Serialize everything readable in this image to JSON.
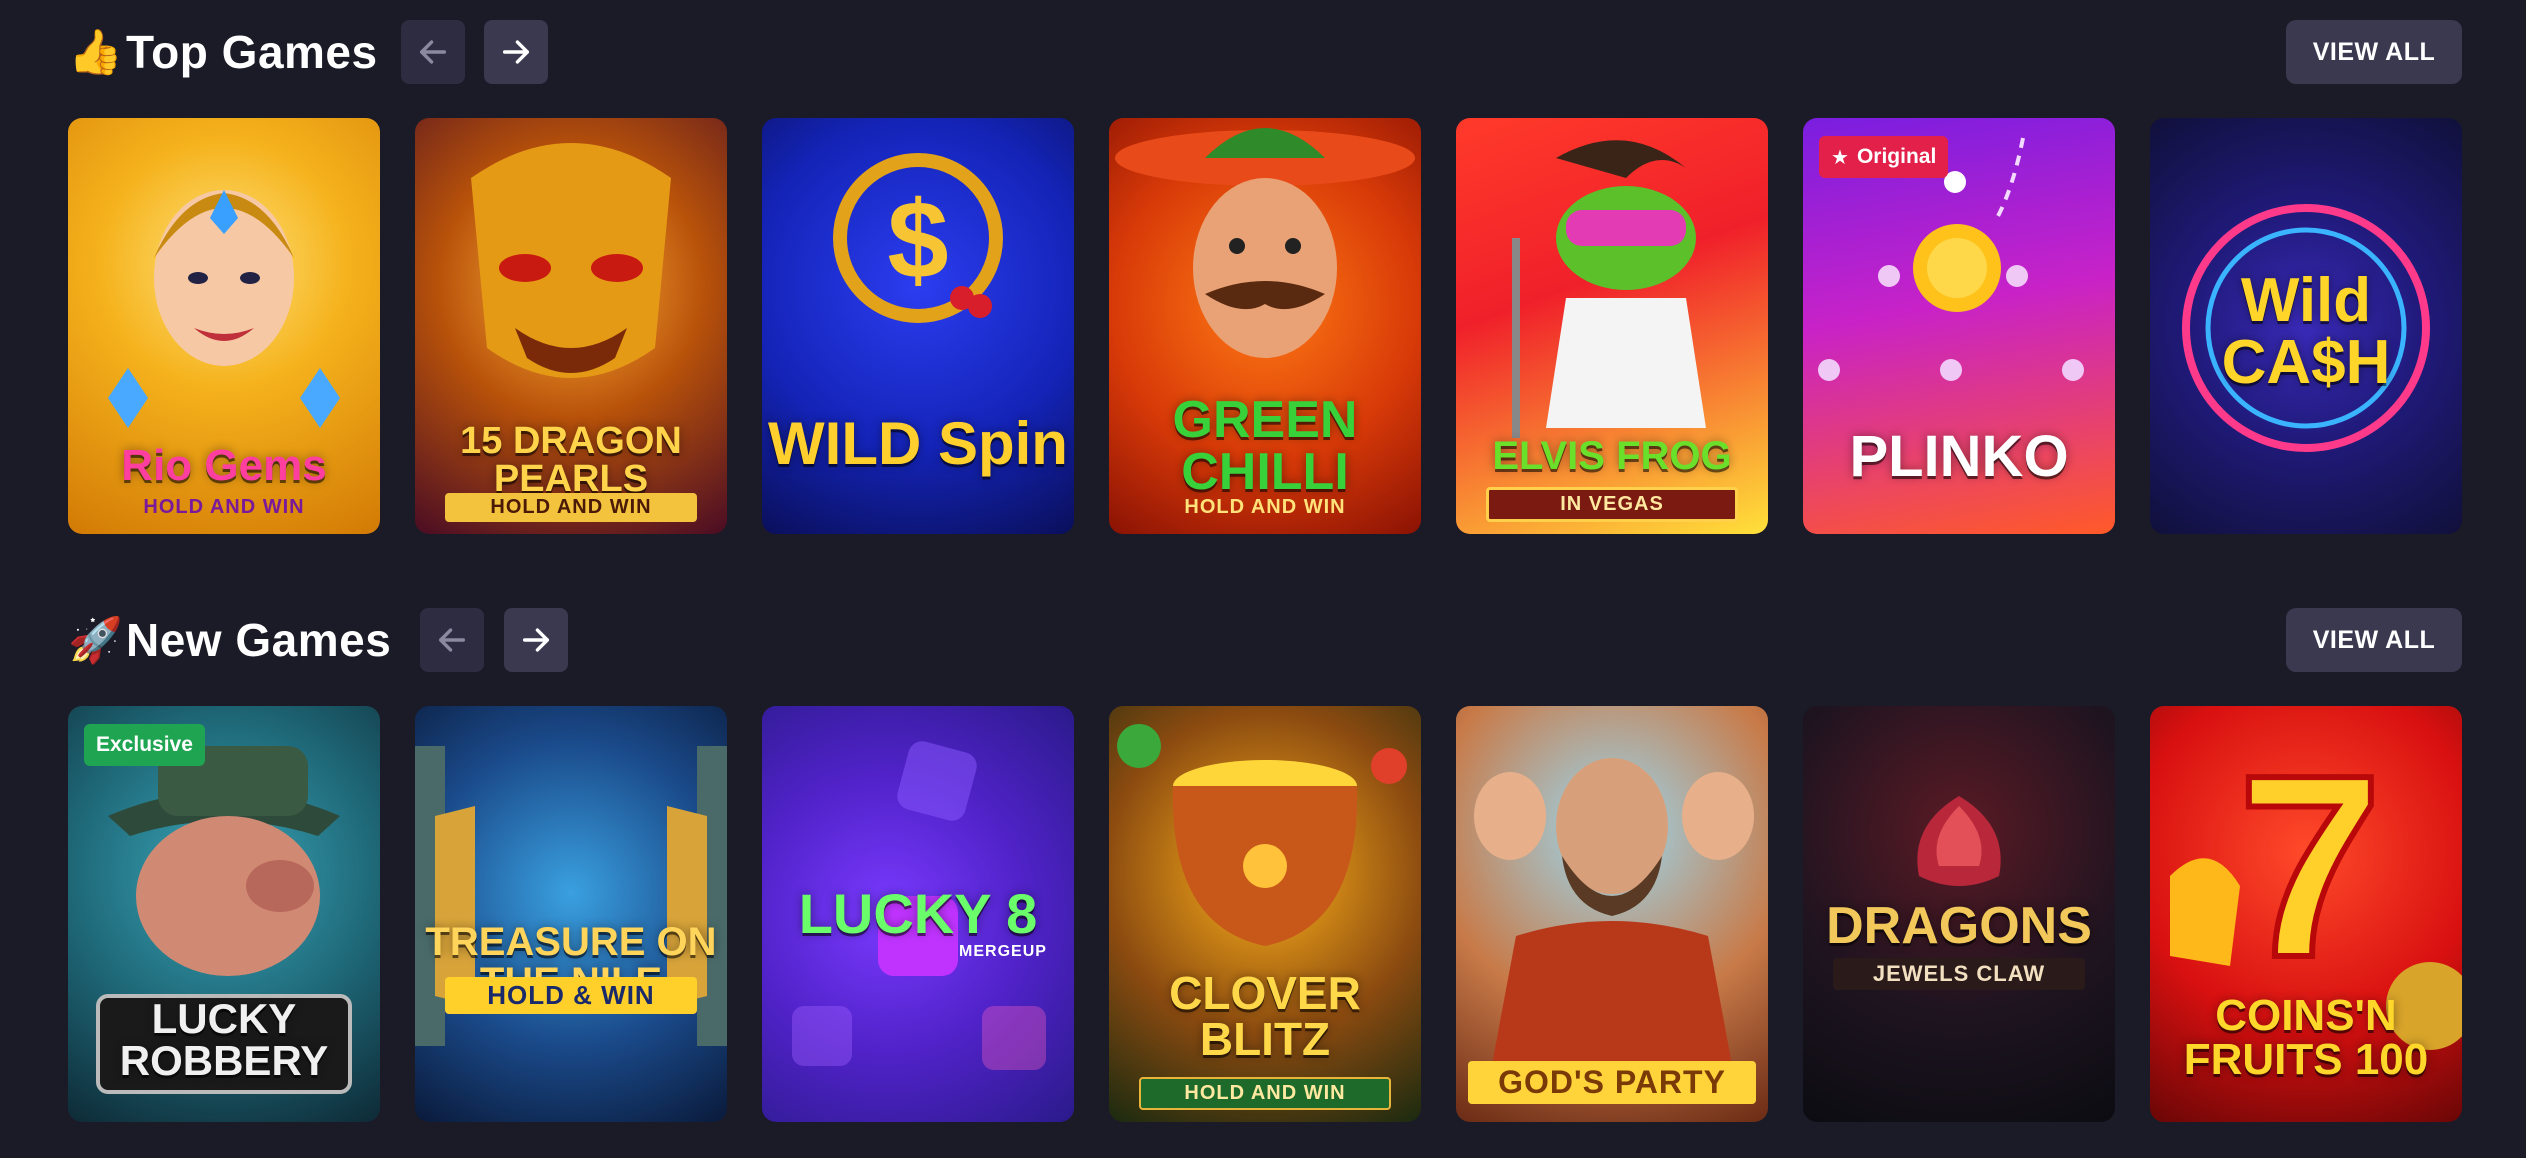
{
  "top_games": {
    "emoji": "👍",
    "title": "Top Games",
    "view_all": "VIEW ALL",
    "games": [
      {
        "name": "Rio Gems",
        "sub": "HOLD AND WIN"
      },
      {
        "name": "15 DRAGON PEARLS",
        "sub": "HOLD AND WIN"
      },
      {
        "name": "WILD Spin",
        "sub": ""
      },
      {
        "name": "GREEN CHILLI",
        "sub": "HOLD AND WIN"
      },
      {
        "name": "ELVIS FROG",
        "sub": "IN VEGAS"
      },
      {
        "name": "PLINKO",
        "sub": "",
        "badge": "Original"
      },
      {
        "name": "Wild CA$H",
        "sub": ""
      }
    ]
  },
  "new_games": {
    "emoji": "🚀",
    "title": "New Games",
    "view_all": "VIEW ALL",
    "games": [
      {
        "name": "LUCKY ROBBERY",
        "sub": "",
        "badge": "Exclusive"
      },
      {
        "name": "TREASURE ON THE NILE",
        "sub": "HOLD & WIN"
      },
      {
        "name": "LUCKY 8",
        "sub": "MERGEUP"
      },
      {
        "name": "CLOVER BLITZ",
        "sub": "HOLD AND WIN"
      },
      {
        "name": "",
        "sub": "GOD'S PARTY"
      },
      {
        "name": "DRAGONS",
        "sub": "JEWELS CLAW"
      },
      {
        "name": "COINS'N FRUITS 100",
        "sub": ""
      }
    ]
  },
  "colors": {
    "background": "#1b1a27",
    "button": "#3a3950",
    "badge_original": "#e2204a",
    "badge_exclusive": "#1fa552"
  }
}
